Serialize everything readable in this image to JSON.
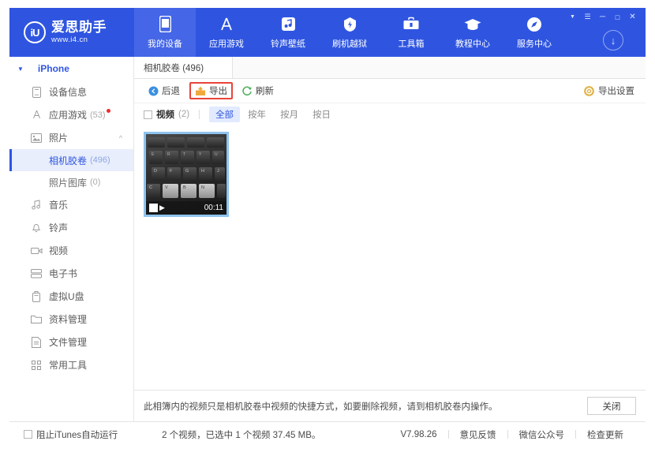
{
  "window": {
    "controls": [
      {
        "name": "pin-icon",
        "glyph": "▼"
      },
      {
        "name": "menu-icon",
        "glyph": "☰"
      },
      {
        "name": "minimize-icon",
        "glyph": "─"
      },
      {
        "name": "maximize-icon",
        "glyph": "□"
      },
      {
        "name": "close-icon",
        "glyph": "✕"
      }
    ],
    "download_glyph": "↓"
  },
  "brand": {
    "logo_text": "iU",
    "name": "爱思助手",
    "url": "www.i4.cn"
  },
  "nav": {
    "items": [
      {
        "label": "我的设备",
        "icon": "device-icon",
        "active": true
      },
      {
        "label": "应用游戏",
        "icon": "appstore-icon",
        "active": false
      },
      {
        "label": "铃声壁纸",
        "icon": "music-note-icon",
        "active": false
      },
      {
        "label": "刷机越狱",
        "icon": "flash-icon",
        "active": false
      },
      {
        "label": "工具箱",
        "icon": "toolbox-icon",
        "active": false
      },
      {
        "label": "教程中心",
        "icon": "graduation-cap-icon",
        "active": false
      },
      {
        "label": "服务中心",
        "icon": "compass-icon",
        "active": false
      }
    ]
  },
  "sidebar": {
    "device": {
      "name": "iPhone",
      "caret": "▼"
    },
    "items": [
      {
        "label": "设备信息",
        "icon": "device-info-icon",
        "count": "",
        "badge": false
      },
      {
        "label": "应用游戏",
        "icon": "apps-icon",
        "count": "(53)",
        "badge": true
      },
      {
        "label": "照片",
        "icon": "photo-icon",
        "count": "",
        "badge": false,
        "expanded": true
      },
      {
        "label": "音乐",
        "icon": "music-icon",
        "count": "",
        "badge": false
      },
      {
        "label": "铃声",
        "icon": "bell-icon",
        "count": "",
        "badge": false
      },
      {
        "label": "视频",
        "icon": "video-icon",
        "count": "",
        "badge": false
      },
      {
        "label": "电子书",
        "icon": "book-icon",
        "count": "",
        "badge": false
      },
      {
        "label": "虚拟U盘",
        "icon": "usb-icon",
        "count": "",
        "badge": false
      },
      {
        "label": "资料管理",
        "icon": "folder-icon",
        "count": "",
        "badge": false
      },
      {
        "label": "文件管理",
        "icon": "file-icon",
        "count": "",
        "badge": false
      },
      {
        "label": "常用工具",
        "icon": "grid-icon",
        "count": "",
        "badge": false
      }
    ],
    "sub_items": [
      {
        "label": "相机胶卷",
        "count": "(496)",
        "selected": true
      },
      {
        "label": "照片图库",
        "count": "(0)",
        "selected": false
      }
    ]
  },
  "content": {
    "tab": {
      "label": "相机胶卷 (496)"
    },
    "toolbar": {
      "back_label": "后退",
      "export_label": "导出",
      "refresh_label": "刷新",
      "export_settings_label": "导出设置"
    },
    "filter": {
      "checkbox_label": "视频",
      "checkbox_count": "(2)",
      "segments": [
        {
          "label": "全部",
          "active": true
        },
        {
          "label": "按年",
          "active": false
        },
        {
          "label": "按月",
          "active": false
        },
        {
          "label": "按日",
          "active": false
        }
      ]
    },
    "items": [
      {
        "duration": "00:11",
        "selected": true,
        "type": "video"
      }
    ],
    "notice": {
      "text": "此相簿内的视频只是相机胶卷中视频的快捷方式，如要删除视频，请到相机胶卷内操作。",
      "close_label": "关闭"
    }
  },
  "statusbar": {
    "itunes_checkbox_label": "阻止iTunes自动运行",
    "info": "2 个视频，已选中 1 个视频 37.45 MB。",
    "version": "V7.98.26",
    "links": [
      {
        "label": "意见反馈"
      },
      {
        "label": "微信公众号"
      },
      {
        "label": "检查更新"
      }
    ]
  },
  "colors": {
    "header_blue": "#2f55e0",
    "nav_active": "#4566e6",
    "accent": "#2f55e0",
    "selection_bg": "#e8eefc",
    "highlight_red": "#e8443a",
    "badge_red": "#f02c2c",
    "thumb_border": "#8fc3ee"
  }
}
